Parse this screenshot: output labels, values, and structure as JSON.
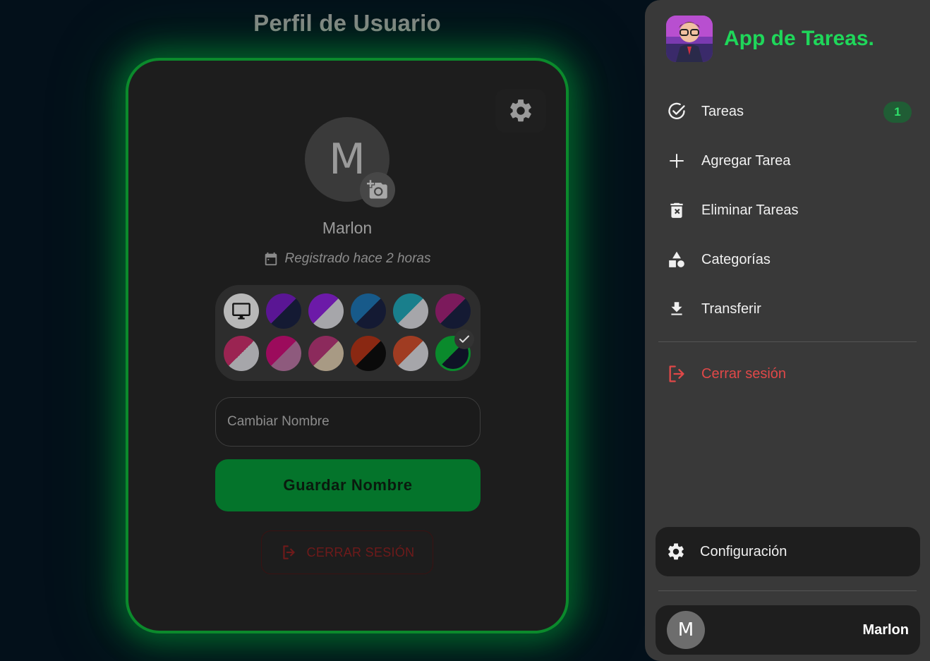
{
  "page": {
    "title": "Perfil de Usuario"
  },
  "profile": {
    "avatar_initial": "M",
    "name": "Marlon",
    "registered": "Registrado hace 2 horas",
    "name_placeholder": "Cambiar Nombre",
    "save_label": "Guardar Nombre",
    "logout_label": "CERRAR SESIÓN"
  },
  "themes": [
    {
      "name": "system",
      "c1": "#b8b8b8",
      "c2": "#b8b8b8",
      "selected": false
    },
    {
      "name": "purple-dark",
      "c1": "#5a1694",
      "c2": "#141a33",
      "selected": false
    },
    {
      "name": "purple-light",
      "c1": "#6c1aa8",
      "c2": "#a6a6aa",
      "selected": false
    },
    {
      "name": "blue-dark",
      "c1": "#175a8a",
      "c2": "#141a33",
      "selected": false
    },
    {
      "name": "teal-light",
      "c1": "#197f8c",
      "c2": "#a6a6aa",
      "selected": false
    },
    {
      "name": "magenta-dark",
      "c1": "#7c1a5c",
      "c2": "#141a33",
      "selected": false
    },
    {
      "name": "rose-light",
      "c1": "#9b2452",
      "c2": "#a6a6aa",
      "selected": false
    },
    {
      "name": "berry",
      "c1": "#9c0b5c",
      "c2": "#8e5a7d",
      "selected": false
    },
    {
      "name": "rose-sand",
      "c1": "#8c2a5c",
      "c2": "#a89a84",
      "selected": false
    },
    {
      "name": "rust-black",
      "c1": "#8a2812",
      "c2": "#0a0a0a",
      "selected": false
    },
    {
      "name": "copper-light",
      "c1": "#a03c22",
      "c2": "#a6a6aa",
      "selected": false
    },
    {
      "name": "green-dark",
      "c1": "#0a8a2c",
      "c2": "#0f1226",
      "selected": true
    }
  ],
  "sidebar": {
    "brand": "App de Tareas.",
    "items": [
      {
        "label": "Tareas",
        "icon": "check-circle-icon",
        "badge": "1"
      },
      {
        "label": "Agregar Tarea",
        "icon": "plus-icon",
        "badge": ""
      },
      {
        "label": "Eliminar Tareas",
        "icon": "trash-icon",
        "badge": ""
      },
      {
        "label": "Categorías",
        "icon": "category-icon",
        "badge": ""
      },
      {
        "label": "Transferir",
        "icon": "download-icon",
        "badge": ""
      }
    ],
    "logout": "Cerrar sesión",
    "settings": "Configuración",
    "user_initial": "M",
    "user_name": "Marlon"
  },
  "colors": {
    "accent": "#1fd75a",
    "danger": "#e04848",
    "card_border": "#0b8a2c"
  }
}
